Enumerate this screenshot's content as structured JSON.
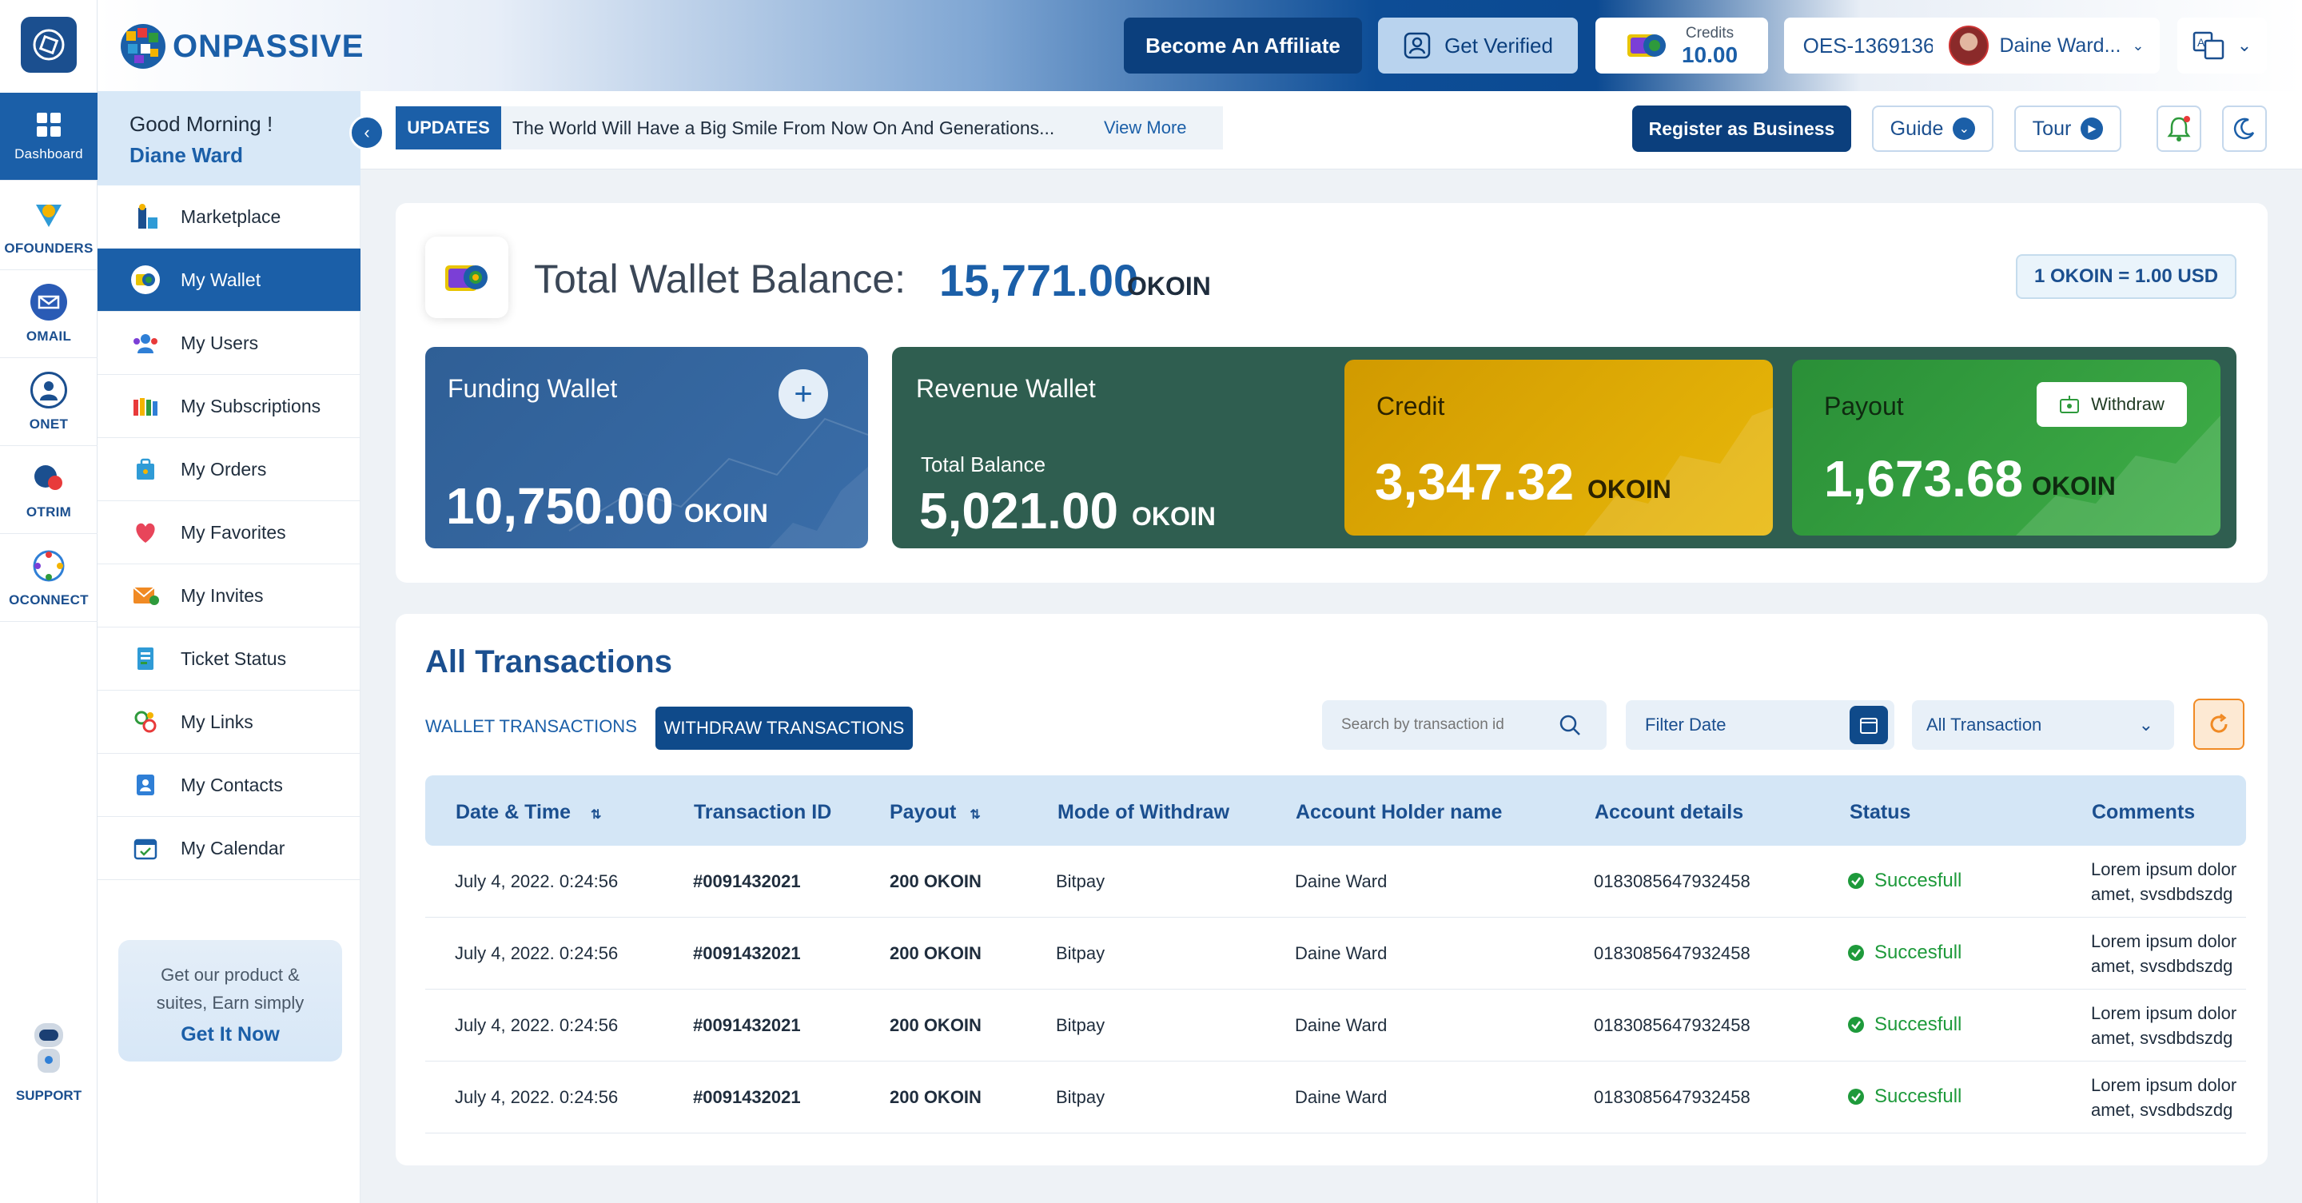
{
  "brand": {
    "name": "ONPASSIVE"
  },
  "rail": {
    "items": [
      {
        "label": "Dashboard",
        "icon": "dashboard-grid-icon"
      },
      {
        "label": "OFOUNDERS",
        "icon": "ofounders-icon"
      },
      {
        "label": "OMAIL",
        "icon": "omail-icon"
      },
      {
        "label": "ONET",
        "icon": "onet-icon"
      },
      {
        "label": "OTRIM",
        "icon": "otrim-icon"
      },
      {
        "label": "OCONNECT",
        "icon": "oconnect-icon"
      }
    ],
    "support": "SUPPORT"
  },
  "header": {
    "affiliate": "Become An Affiliate",
    "verified": "Get Verified",
    "credits_label": "Credits",
    "credits_value": "10.00",
    "account_id": "OES-1369136",
    "user": "Daine Ward..."
  },
  "greeting": {
    "line1": "Good Morning !",
    "name": "Diane Ward"
  },
  "menu": {
    "items": [
      {
        "label": "Marketplace"
      },
      {
        "label": "My Wallet"
      },
      {
        "label": "My Users"
      },
      {
        "label": "My Subscriptions"
      },
      {
        "label": "My Orders"
      },
      {
        "label": "My Favorites"
      },
      {
        "label": "My Invites"
      },
      {
        "label": "Ticket Status"
      },
      {
        "label": "My Links"
      },
      {
        "label": "My Contacts"
      },
      {
        "label": "My Calendar"
      }
    ]
  },
  "promo": {
    "line1": "Get our product &",
    "line2": "suites, Earn simply",
    "cta": "Get It Now"
  },
  "updates": {
    "tag": "UPDATES",
    "message": "The World Will Have a Big Smile From Now On And Generations...",
    "more": "View More"
  },
  "toolbar": {
    "register": "Register as Business",
    "guide": "Guide",
    "tour": "Tour"
  },
  "wallet": {
    "title": "Total Wallet Balance:",
    "amount": "15,771.00",
    "unit": "OKOIN",
    "rate": "1 OKOIN = 1.00 USD",
    "funding": {
      "title": "Funding Wallet",
      "amount": "10,750.00",
      "unit": "OKOIN"
    },
    "revenue": {
      "title": "Revenue Wallet",
      "sub": "Total Balance",
      "amount": "5,021.00",
      "unit": "OKOIN"
    },
    "credit": {
      "title": "Credit",
      "amount": "3,347.32",
      "unit": "OKOIN"
    },
    "payout": {
      "title": "Payout",
      "withdraw": "Withdraw",
      "amount": "1,673.68",
      "unit": "OKOIN"
    }
  },
  "transactions": {
    "title": "All Transactions",
    "tab_wallet": "WALLET TRANSACTIONS",
    "tab_withdraw": "WITHDRAW TRANSACTIONS",
    "search_placeholder": "Search by transaction id",
    "filter_date": "Filter Date",
    "type_select": "All Transaction",
    "columns": [
      "Date & Time",
      "Transaction ID",
      "Payout",
      "Mode of Withdraw",
      "Account Holder name",
      "Account details",
      "Status",
      "Comments"
    ],
    "rows": [
      {
        "date": "July 4, 2022. 0:24:56",
        "id": "#0091432021",
        "payout": "200 OKOIN",
        "mode": "Bitpay",
        "holder": "Daine Ward",
        "account": "0183085647932458",
        "status": "Succesfull",
        "comment1": "Lorem ipsum dolor",
        "comment2": "amet, svsdbdszdg"
      },
      {
        "date": "July 4, 2022. 0:24:56",
        "id": "#0091432021",
        "payout": "200 OKOIN",
        "mode": "Bitpay",
        "holder": "Daine Ward",
        "account": "0183085647932458",
        "status": "Succesfull",
        "comment1": "Lorem ipsum dolor",
        "comment2": "amet, svsdbdszdg"
      },
      {
        "date": "July 4, 2022. 0:24:56",
        "id": "#0091432021",
        "payout": "200 OKOIN",
        "mode": "Bitpay",
        "holder": "Daine Ward",
        "account": "0183085647932458",
        "status": "Succesfull",
        "comment1": "Lorem ipsum dolor",
        "comment2": "amet, svsdbdszdg"
      },
      {
        "date": "July 4, 2022. 0:24:56",
        "id": "#0091432021",
        "payout": "200 OKOIN",
        "mode": "Bitpay",
        "holder": "Daine Ward",
        "account": "0183085647932458",
        "status": "Succesfull",
        "comment1": "Lorem ipsum dolor",
        "comment2": "amet, svsdbdszdg"
      }
    ]
  },
  "colors": {
    "primary": "#1b5fa8",
    "funding": "#2f5f96",
    "revenue": "#2f5e50",
    "credit": "#d9a300",
    "payout": "#2e9a3c",
    "success": "#1e9a3b"
  }
}
